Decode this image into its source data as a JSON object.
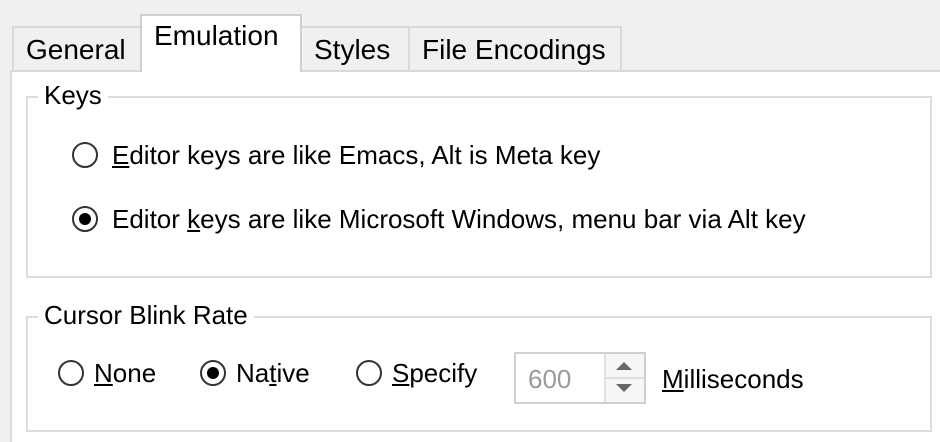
{
  "tabs": [
    {
      "label": "General",
      "active": false
    },
    {
      "label": "Emulation",
      "active": true
    },
    {
      "label": "Styles",
      "active": false
    },
    {
      "label": "File Encodings",
      "active": false
    }
  ],
  "keys_group": {
    "title": "Keys",
    "options": [
      {
        "mnemonic": "E",
        "rest": "ditor keys are like Emacs, Alt is Meta key",
        "selected": false
      },
      {
        "prefix": "Editor ",
        "mnemonic": "k",
        "rest": "eys are like Microsoft Windows, menu bar via Alt key",
        "selected": true
      }
    ]
  },
  "cursor_group": {
    "title": "Cursor Blink Rate",
    "options": [
      {
        "mnemonic": "N",
        "rest": "one",
        "selected": false
      },
      {
        "prefix": "Na",
        "mnemonic": "t",
        "rest": "ive",
        "selected": true
      },
      {
        "mnemonic": "S",
        "rest": "pecify",
        "selected": false
      }
    ],
    "spinner_value": "600",
    "units_mnemonic": "M",
    "units_rest": "illiseconds"
  }
}
